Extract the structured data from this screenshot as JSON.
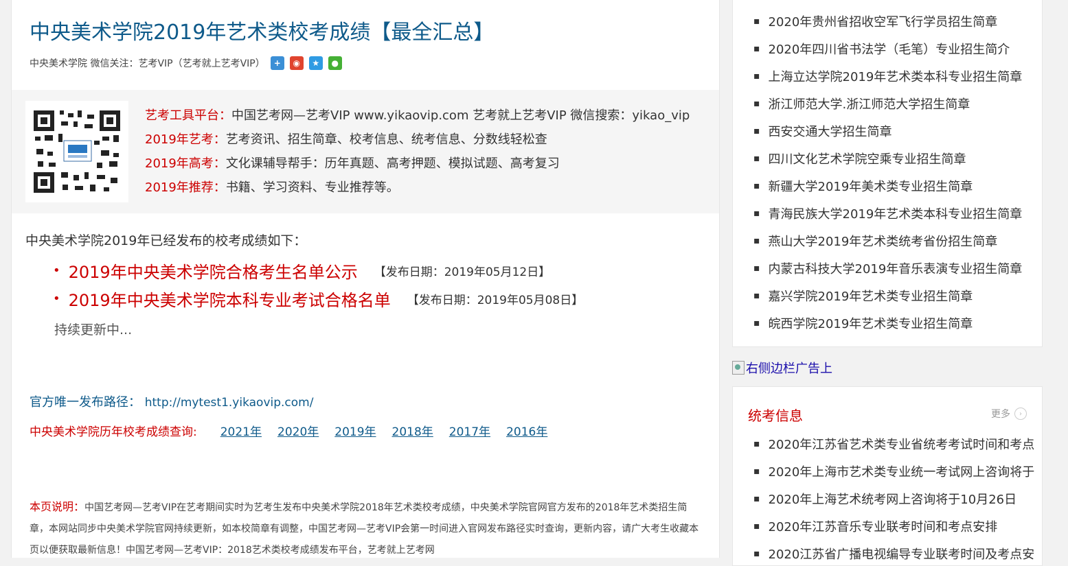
{
  "article": {
    "title": "中央美术学院2019年艺术类校考成绩【最全汇总】",
    "meta": "中央美术学院 微信关注：艺考VIP（艺考就上艺考VIP）",
    "share_icons": [
      "add-icon",
      "weibo-icon",
      "qzone-icon",
      "wechat-icon"
    ],
    "promo": [
      {
        "label": "艺考工具平台：",
        "text": "中国艺考网—艺考VIP www.yikaovip.com 艺考就上艺考VIP 微信搜索：yikao_vip"
      },
      {
        "label": "2019年艺考：",
        "text": "艺考资讯、招生简章、校考信息、统考信息、分数线轻松查"
      },
      {
        "label": "2019年高考：",
        "text": "文化课辅导帮手：历年真题、高考押题、模拟试题、高考复习"
      },
      {
        "label": "2019年推荐：",
        "text": "书籍、学习资料、专业推荐等。"
      }
    ],
    "intro": "中央美术学院2019年已经发布的校考成绩如下：",
    "results": [
      {
        "title": "2019年中央美术学院合格考生名单公示",
        "date": "【发布日期：2019年05月12日】"
      },
      {
        "title": "2019年中央美术学院本科专业考试合格名单",
        "date": "【发布日期：2019年05月08日】"
      }
    ],
    "updating": "持续更新中...",
    "official_label": "官方唯一发布路径：",
    "official_url": "http://mytest1.yikaovip.com/",
    "history_label": "中央美术学院历年校考成绩查询:",
    "history_years": [
      "2021年",
      "2020年",
      "2019年",
      "2018年",
      "2017年",
      "2016年"
    ],
    "note_label": "本页说明：",
    "note_text": "中国艺考网—艺考VIP在艺考期间实时为艺考生发布中央美术学院2018年艺术类校考成绩，中央美术学院官网官方发布的2018年艺术类招生简章，本网站同步中央美术学院官网持续更新，如本校简章有调整，中国艺考网—艺考VIP会第一时间进入官网发布路径实时查询，更新内容，请广大考生收藏本页以便获取最新信息！中国艺考网—艺考VIP：2018艺术类校考成绩发布平台，艺考就上艺考网"
  },
  "sidebar": {
    "top_list": [
      "2020年贵州省招收空军飞行学员招生简章",
      "2020年四川省书法学（毛笔）专业招生简介",
      "上海立达学院2019年艺术类本科专业招生简章",
      "浙江师范大学.浙江师范大学招生简章",
      "西安交通大学招生简章",
      "四川文化艺术学院空乘专业招生简章",
      "新疆大学2019年美术类专业招生简章",
      "青海民族大学2019年艺术类本科专业招生简章",
      "燕山大学2019年艺术类统考省份招生简章",
      "内蒙古科技大学2019年音乐表演专业招生简章",
      "嘉兴学院2019年艺术类专业招生简章",
      "皖西学院2019年艺术类专业招生简章"
    ],
    "ad_alt": "右侧边栏广告上",
    "unified": {
      "title": "统考信息",
      "more": "更多",
      "items": [
        "2020年江苏省艺术类专业省统考考试时间和考点",
        "2020年上海市艺术类专业统一考试网上咨询将于",
        "2020年上海艺术统考网上咨询将于10月26日",
        "2020年江苏音乐专业联考时间和考点安排",
        "2020江苏省广播电视编导专业联考时间及考点安"
      ]
    }
  }
}
